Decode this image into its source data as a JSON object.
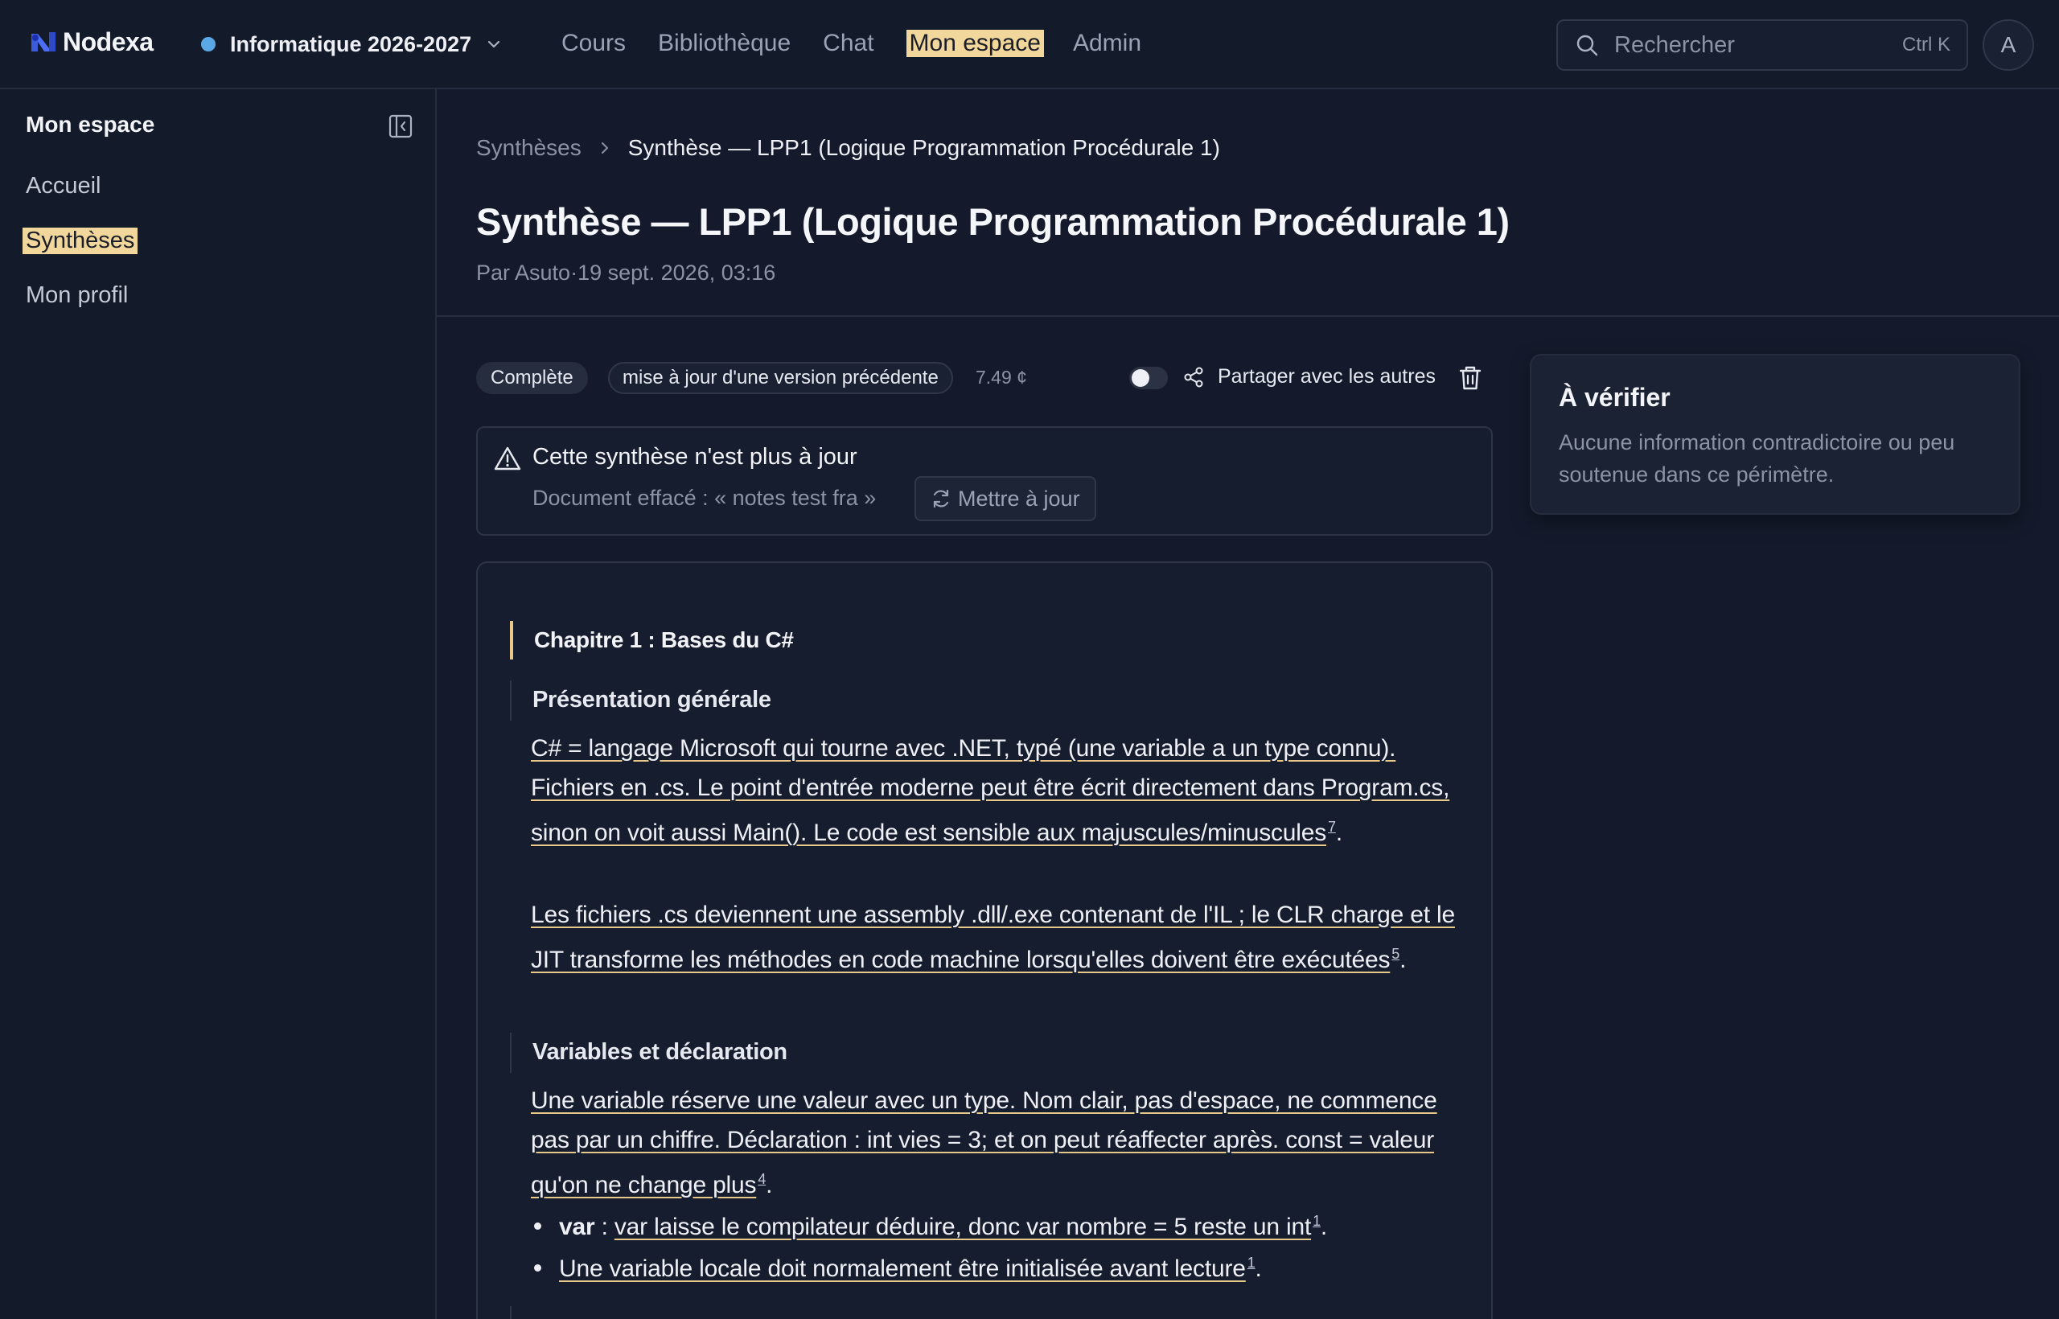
{
  "app": {
    "name": "Nodexa",
    "workspace": "Informatique 2026-2027",
    "nav": [
      "Cours",
      "Bibliothèque",
      "Chat",
      "Mon espace",
      "Admin"
    ],
    "active_nav": "Mon espace",
    "search_placeholder": "Rechercher",
    "search_shortcut": "Ctrl K",
    "avatar_initial": "A",
    "colors": {
      "accent_highlight": "#f1d79c",
      "workspace_dot": "#5ba8e6",
      "background": "#141a2b"
    }
  },
  "sidebar": {
    "title": "Mon espace",
    "items": [
      "Accueil",
      "Synthèses",
      "Mon profil"
    ],
    "active": "Synthèses"
  },
  "breadcrumb": {
    "parent": "Synthèses",
    "current": "Synthèse — LPP1 (Logique Programmation Procédurale 1)"
  },
  "page": {
    "title": "Synthèse — LPP1 (Logique Programmation Procédurale 1)",
    "author": "Par Asuto",
    "separator": "·",
    "date": "19 sept. 2026, 03:16"
  },
  "toolbar": {
    "status_badge": "Complète",
    "update_badge": "mise à jour d'une version précédente",
    "cost": "7.49 ¢",
    "share_label": "Partager avec les autres",
    "share_enabled": false
  },
  "warning": {
    "title": "Cette synthèse n'est plus à jour",
    "detail": "Document effacé : « notes test fra »",
    "button": "Mettre à jour"
  },
  "content": {
    "chapter": "Chapitre 1 : Bases du C#",
    "sections": [
      {
        "title": "Présentation générale",
        "paragraphs": [
          {
            "text": "C# = langage Microsoft qui tourne avec .NET, typé (une variable a un type connu). Fichiers en .cs. Le point d'entrée moderne peut être écrit directement dans Program.cs, sinon on voit aussi Main(). Le code est sensible aux majuscules/minuscules",
            "ref": "7"
          },
          {
            "text": "Les fichiers .cs deviennent une assembly .dll/.exe contenant de l'IL ; le CLR charge et le JIT transforme les méthodes en code machine lorsqu'elles doivent être exécutées",
            "ref": "5"
          }
        ]
      },
      {
        "title": "Variables et déclaration",
        "paragraphs": [
          {
            "text": "Une variable réserve une valeur avec un type. Nom clair, pas d'espace, ne commence pas par un chiffre. Déclaration : int vies = 3; et on peut réaffecter après. const = valeur qu'on ne change plus",
            "ref": "4"
          }
        ],
        "bullets": [
          {
            "term": "var",
            "sep": " : ",
            "text": "var laisse le compilateur déduire, donc var nombre = 5 reste un int",
            "ref": "1"
          },
          {
            "text": "Une variable locale doit normalement être initialisée avant lecture",
            "ref": "1"
          }
        ]
      }
    ]
  },
  "verify": {
    "title": "À vérifier",
    "text": "Aucune information contradictoire ou peu soutenue dans ce périmètre."
  }
}
